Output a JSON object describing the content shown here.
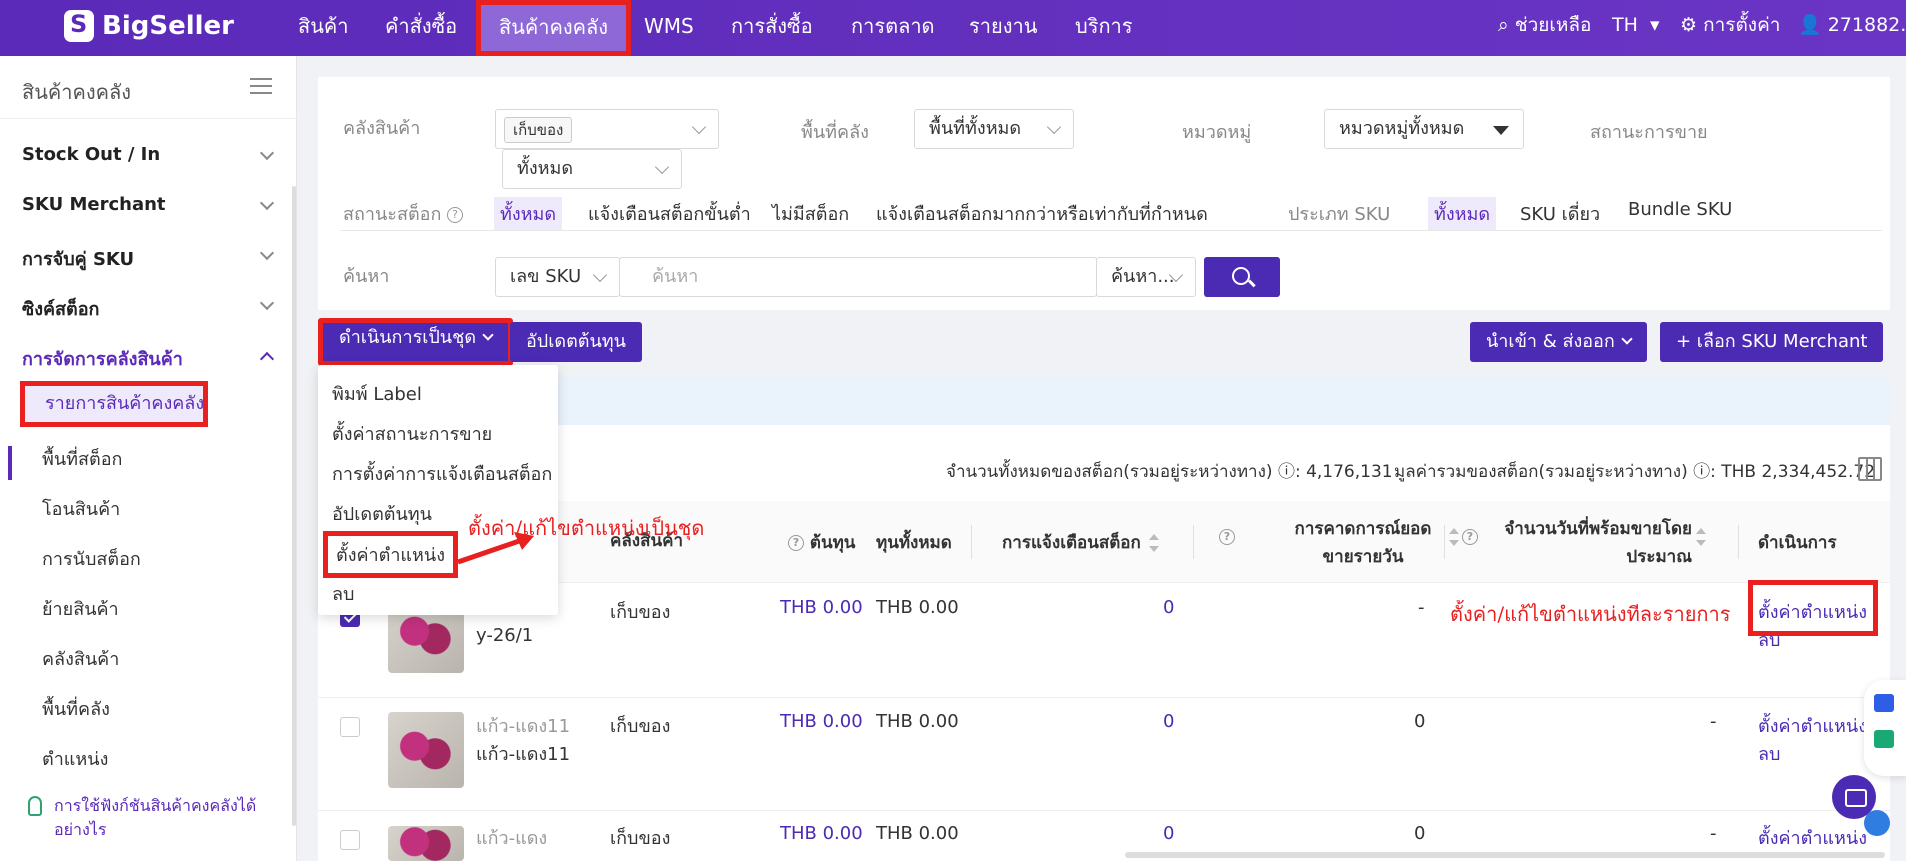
{
  "brand": "BigSeller",
  "nav": {
    "items": [
      "สินค้า",
      "คำสั่งซื้อ",
      "สินค้าคงคลัง",
      "WMS",
      "การสั่งซื้อ",
      "การตลาด",
      "รายงาน",
      "บริการ"
    ],
    "help": "ช่วยเหลือ",
    "lang": "TH",
    "settings": "การตั้งค่า",
    "user": "271882..."
  },
  "sidebar": {
    "title": "สินค้าคงคลัง",
    "groups": [
      "Stock Out / In",
      "SKU Merchant",
      "การจับคู่ SKU",
      "ซิงค์สต็อก",
      "การจัดการคลังสินค้า"
    ],
    "subitems": [
      "รายการสินค้าคงคลัง",
      "พื้นที่สต็อก",
      "โอนสินค้า",
      "การนับสต็อก",
      "ย้ายสินค้า",
      "คลังสินค้า",
      "พื้นที่คลัง",
      "ตำแหน่ง"
    ],
    "tip": "การใช้ฟังก์ชันสินค้าคงคลังได้อย่างไร"
  },
  "filters": {
    "warehouse_label": "คลังสินค้า",
    "warehouse_tag": "เก็บของ",
    "warehouse_all": "ทั้งหมด",
    "area_label": "พื้นที่คลัง",
    "area_value": "พื้นที่ทั้งหมด",
    "category_label": "หมวดหมู่",
    "category_value": "หมวดหมู่ทั้งหมด",
    "sales_status_label": "สถานะการขาย",
    "stock_status_label": "สถานะสต็อก",
    "stock_status_options": [
      "ทั้งหมด",
      "แจ้งเตือนสต็อกขั้นต่ำ",
      "ไม่มีสต็อก",
      "แจ้งเตือนสต็อกมากกว่าหรือเท่ากับที่กำหนด"
    ],
    "sku_type_label": "ประเภท SKU",
    "sku_type_options": [
      "ทั้งหมด",
      "SKU เดี่ยว",
      "Bundle SKU"
    ],
    "search_label": "ค้นหา",
    "search_field": "เลข SKU",
    "search_placeholder": "ค้นหา",
    "search_mode": "ค้นหา..."
  },
  "toolbar": {
    "batch": "ดำเนินการเป็นชุด",
    "update_cost": "อัปเดตต้นทุน",
    "import_export": "นำเข้า & ส่งออก",
    "choose_sku": "+ เลือก SKU Merchant"
  },
  "stats": {
    "total_qty": "จำนวนทั้งหมดของสต็อก(รวมอยู่ระหว่างทาง) ⓘ: 4,176,131",
    "total_value": "มูลค่ารวมของสต็อก(รวมอยู่ระหว่างทาง) ⓘ: THB 2,334,452.72"
  },
  "batch_menu": [
    "พิมพ์ Label",
    "ตั้งค่าสถานะการขาย",
    "การตั้งค่าการแจ้งเตือนสต็อก",
    "อัปเดตต้นทุน",
    "ตั้งค่าตำแหน่ง",
    "ลบ"
  ],
  "table": {
    "headers": {
      "warehouse": "คลังสินค้า",
      "cost": "ต้นทุน",
      "total_cost": "ทุนทั้งหมด",
      "alert": "การแจ้งเตือนสต็อก",
      "forecast": "การคาดการณ์ยอดขายรายวัน",
      "days": "จำนวนวันที่พร้อมขายโดยประมาณ",
      "action": "ดำเนินการ"
    },
    "rows": [
      {
        "sku1": "",
        "sku2": "y-26/1",
        "warehouse": "เก็บของ",
        "cost": "THB 0.00",
        "total": "THB 0.00",
        "alert": "0",
        "forecast": "-",
        "days": "",
        "checked": true
      },
      {
        "sku1": "แก้ว-แดง11",
        "sku2": "แก้ว-แดง11",
        "warehouse": "เก็บของ",
        "cost": "THB 0.00",
        "total": "THB 0.00",
        "alert": "0",
        "forecast": "0",
        "days": "-",
        "checked": false
      },
      {
        "sku1": "แก้ว-แดง",
        "sku2": "",
        "warehouse": "เก็บของ",
        "cost": "THB 0.00",
        "total": "THB 0.00",
        "alert": "0",
        "forecast": "0",
        "days": "-",
        "checked": false
      }
    ],
    "action_set": "ตั้งค่าตำแหน่ง",
    "action_delete": "ลบ"
  },
  "annotations": {
    "batch": "ตั้งค่า/แก้ไขตำแหน่งเป็นชุด",
    "single": "ตั้งค่า/แก้ไขตำแหน่งทีละรายการ"
  }
}
